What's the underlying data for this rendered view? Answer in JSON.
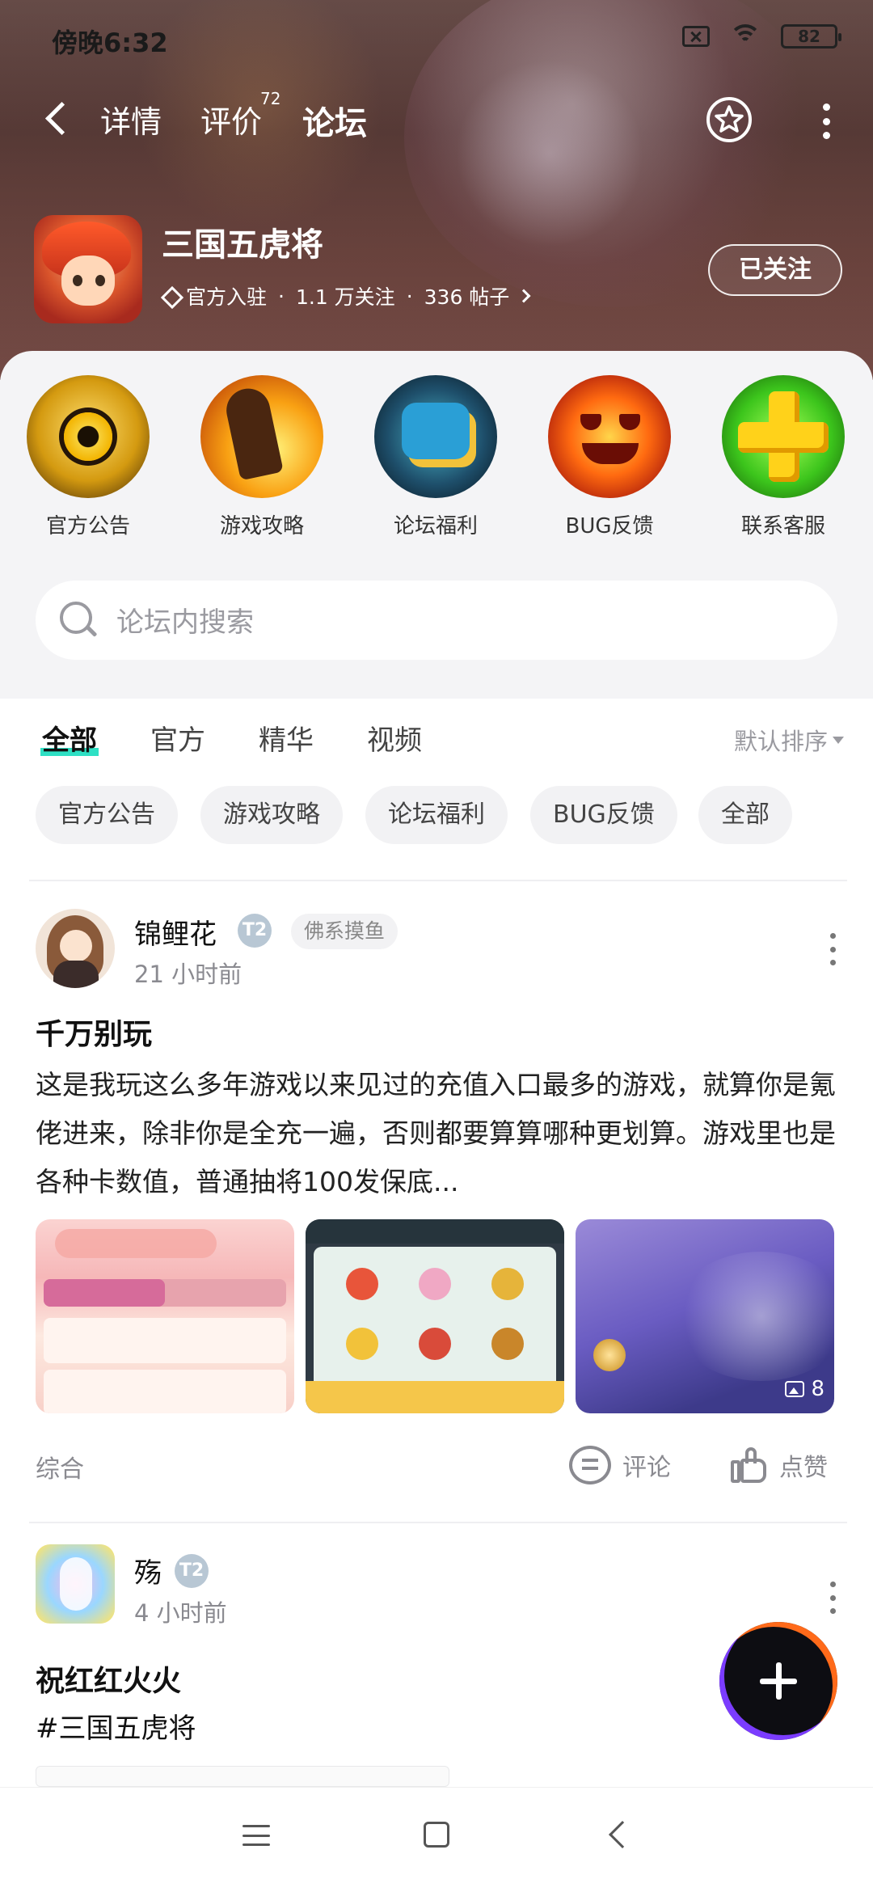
{
  "status_bar": {
    "time": "傍晚6:32",
    "battery": "82"
  },
  "nav": {
    "tabs": [
      {
        "label": "详情"
      },
      {
        "label": "评价",
        "count": "72"
      },
      {
        "label": "论坛"
      }
    ],
    "active_tab": "论坛"
  },
  "game": {
    "name": "三国五虎将",
    "verified": "官方入驻",
    "followers": "1.1 万关注",
    "posts": "336 帖子",
    "follow_label": "已关注"
  },
  "categories": [
    {
      "label": "官方公告",
      "icon": "eye-icon"
    },
    {
      "label": "游戏攻略",
      "icon": "fist-icon"
    },
    {
      "label": "论坛福利",
      "icon": "gift-hand-icon"
    },
    {
      "label": "BUG反馈",
      "icon": "pumpkin-icon"
    },
    {
      "label": "联系客服",
      "icon": "plus-cross-icon"
    }
  ],
  "search": {
    "placeholder": "论坛内搜索"
  },
  "filter_tabs": [
    "全部",
    "官方",
    "精华",
    "视频"
  ],
  "sort_label": "默认排序",
  "chips": [
    "官方公告",
    "游戏攻略",
    "论坛福利",
    "BUG反馈",
    "全部"
  ],
  "posts": [
    {
      "username": "锦鲤花",
      "level": "T2",
      "tag": "佛系摸鱼",
      "time": "21 小时前",
      "title": "千万别玩",
      "body": "这是我玩这么多年游戏以来见过的充值入口最多的游戏，就算你是氪佬进来，除非你是全充一遍，否则都要算算哪种更划算。游戏里也是各种卡数值，普通抽将100发保底...",
      "image_count": "8",
      "category": "综合",
      "comment_label": "评论",
      "like_label": "点赞"
    },
    {
      "username": "殇",
      "level": "T2",
      "time": "4 小时前",
      "title": "祝红红火火",
      "hashtag": "#三国五虎将"
    }
  ],
  "colors": {
    "accent": "#2ee0c4",
    "muted": "#8a8a90"
  }
}
